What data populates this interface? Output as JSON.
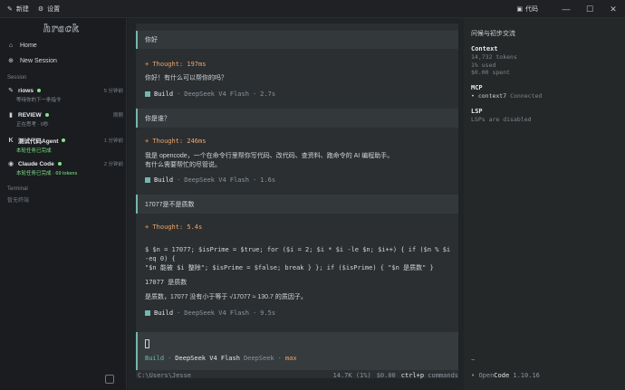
{
  "titlebar": {
    "new_label": "新建",
    "settings_label": "设置",
    "code_label": "代码"
  },
  "sidebar": {
    "logo": "hrack",
    "nav": [
      {
        "label": "Home",
        "icon": "home-icon"
      },
      {
        "label": "New Session",
        "icon": "plus-icon"
      }
    ],
    "session_heading": "Session",
    "sessions": [
      {
        "title": "riows",
        "dot": true,
        "time": "5 分钟前",
        "subtitle": "等待你的下一条指令",
        "subtitle_green": false
      },
      {
        "title": "REVIEW",
        "dot": true,
        "time": "刚刚",
        "subtitle": "正在思考 · 0秒",
        "subtitle_green": false
      },
      {
        "title": "测试代码Agent",
        "dot": true,
        "time": "1 分钟前",
        "subtitle": "本轮任务已完成",
        "subtitle_green": true
      },
      {
        "title": "Claude Code",
        "dot": true,
        "time": "2 分钟前",
        "subtitle": "本轮任务已完成 · 69 tokens",
        "subtitle_green": true
      }
    ],
    "terminal_heading": "Terminal",
    "terminal_empty": "暂无终端"
  },
  "chat": {
    "messages": [
      {
        "user": "你好",
        "thought": "+ Thought: 197ms",
        "reply": "你好！有什么可以帮你的吗？",
        "agent": "Build",
        "model": "DeepSeek V4 Flash",
        "duration": "2.7s"
      },
      {
        "user": "你是谁？",
        "thought": "+ Thought: 246ms",
        "reply_lines": [
          "我是 opencode，一个在命令行里帮你写代码、改代码、查资料、跑命令的 AI 编程助手。",
          "有什么需要帮忙的尽管说。"
        ],
        "agent": "Build",
        "model": "DeepSeek V4 Flash",
        "duration": "1.6s"
      },
      {
        "user": "17077是不是质数",
        "thought": "+ Thought: 5.4s",
        "code_lines": [
          "$ $n = 17077; $isPrime = $true; for ($i = 2; $i * $i -le $n; $i++) { if ($n % $i -eq 0) {",
          "\"$n 能被 $i 整除\"; $isPrime = $false; break } }; if ($isPrime) { \"$n 是质数\" }"
        ],
        "code_output": "17077 是质数",
        "reply": "是质数，17077 没有小于等于 √17077 ≈ 130.7 的质因子。",
        "agent": "Build",
        "model": "DeepSeek V4 Flash",
        "duration": "9.5s"
      }
    ],
    "sep": "·"
  },
  "input": {
    "agent": "Build",
    "model": "DeepSeek V4 Flash",
    "provider": "DeepSeek",
    "effort": "max",
    "sep": "·"
  },
  "bottom": {
    "path": "C:\\Users\\Jesse",
    "tokens": "14.7K (1%)",
    "cost": "$0.00",
    "shortcut": "ctrl+p",
    "shortcut_label": "commands"
  },
  "right_panel": {
    "title": "问候与初步交流",
    "context_heading": "Context",
    "context_lines": [
      "14,732 tokens",
      "1% used",
      "$0.00 spent"
    ],
    "mcp_heading": "MCP",
    "mcp_name": "context7",
    "mcp_status": "Connected",
    "lsp_heading": "LSP",
    "lsp_status": "LSPs are disabled",
    "cwd": "~",
    "footer_open": "Open",
    "footer_code": "Code",
    "version": "1.10.16"
  }
}
